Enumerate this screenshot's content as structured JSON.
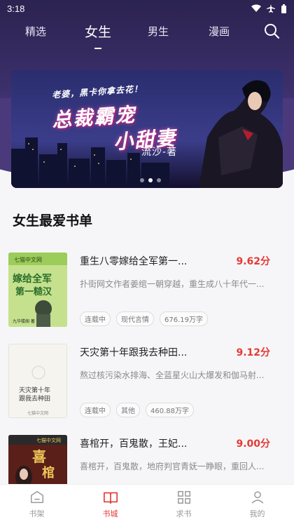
{
  "status": {
    "time": "3:18"
  },
  "nav": {
    "tabs": [
      {
        "label": "精选",
        "active": false
      },
      {
        "label": "女生",
        "active": true
      },
      {
        "label": "男生",
        "active": false
      },
      {
        "label": "漫画",
        "active": false
      }
    ],
    "search_icon": "search-icon"
  },
  "banner": {
    "tagline": "老婆，黑卡你拿去花！",
    "title_line1": "总裁霸宠",
    "title_line2": "小甜妻",
    "author": "流沙-著",
    "slides": 3,
    "current_slide": 2
  },
  "section": {
    "title": "女生最爱书单"
  },
  "books": [
    {
      "name": "重生八零嫁给全军第一...",
      "score": "9.62分",
      "desc": "扑街网文作者姜绾一朝穿越，重生成八十年代一...",
      "tags": [
        "连载中",
        "现代言情",
        "676.19万字"
      ],
      "cover_color": "#b7d97a"
    },
    {
      "name": "天灾第十年跟我去种田...",
      "score": "9.12分",
      "desc": "熬过核污染水排海、全蓝星火山大爆发和伽马射...",
      "tags": [
        "连载中",
        "其他",
        "460.88万字"
      ],
      "cover_color": "#f3f1ec"
    },
    {
      "name": "喜棺开，百鬼散，王妃...",
      "score": "9.00分",
      "desc": "喜棺开，百鬼散，地府判官青妩一睁眼，重回人...",
      "tags": [],
      "cover_color": "#6b2a1f"
    }
  ],
  "tabbar": {
    "items": [
      {
        "label": "书架",
        "icon": "bookshelf-icon",
        "active": false
      },
      {
        "label": "书城",
        "icon": "book-open-icon",
        "active": true
      },
      {
        "label": "求书",
        "icon": "grid-icon",
        "active": false
      },
      {
        "label": "我的",
        "icon": "user-icon",
        "active": false
      }
    ]
  },
  "colors": {
    "accent": "#e53935",
    "header": "#3b2f6a",
    "score": "#e53935"
  }
}
